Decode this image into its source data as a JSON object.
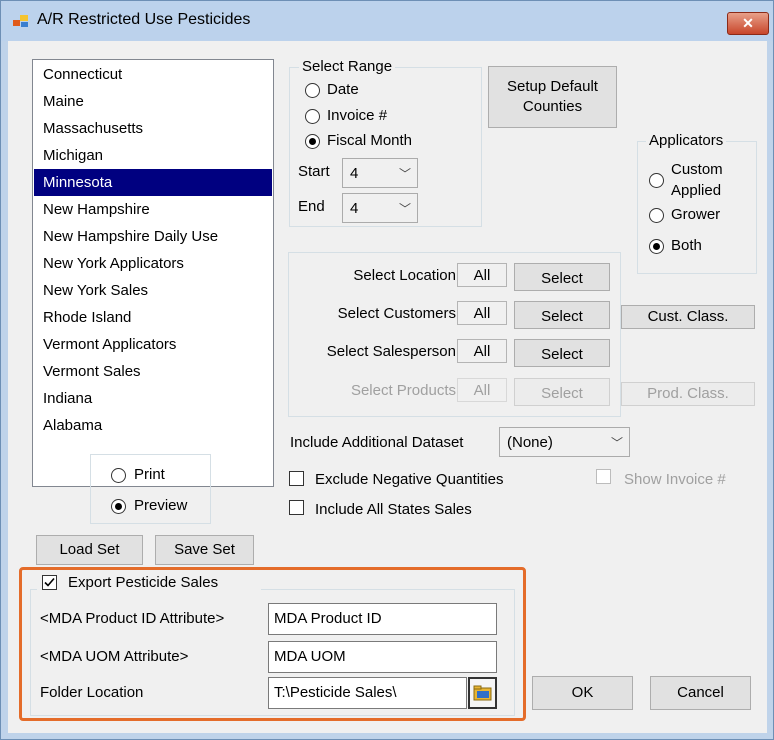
{
  "window": {
    "title": "A/R Restricted Use Pesticides",
    "close_label": "✕"
  },
  "states": {
    "items": [
      "Connecticut",
      "Maine",
      "Massachusetts",
      "Michigan",
      "Minnesota",
      "New Hampshire",
      "New Hampshire Daily Use",
      "New York Applicators",
      "New York Sales",
      "Rhode Island",
      "Vermont Applicators",
      "Vermont Sales",
      "Indiana",
      "Alabama"
    ],
    "selected": "Minnesota"
  },
  "output": {
    "print_label": "Print",
    "preview_label": "Preview",
    "selected": "Preview"
  },
  "buttons": {
    "load_set": "Load Set",
    "save_set": "Save Set",
    "setup_counties": "Setup Default Counties",
    "ok": "OK",
    "cancel": "Cancel"
  },
  "select_range": {
    "title": "Select Range",
    "date_label": "Date",
    "invoice_label": "Invoice #",
    "fiscal_label": "Fiscal Month",
    "selected": "Fiscal Month",
    "start_label": "Start",
    "start_value": "4",
    "end_label": "End",
    "end_value": "4"
  },
  "applicators": {
    "title": "Applicators",
    "custom_label_1": "Custom",
    "custom_label_2": "Applied",
    "grower_label": "Grower",
    "both_label": "Both",
    "selected": "Both"
  },
  "filters": {
    "location_label": "Select Location",
    "customers_label": "Select Customers",
    "salesperson_label": "Select Salesperson",
    "products_label": "Select Products",
    "all_text": "All",
    "select_text": "Select",
    "cust_class": "Cust. Class.",
    "prod_class": "Prod. Class."
  },
  "dataset": {
    "label": "Include Additional Dataset",
    "value": "(None)"
  },
  "options": {
    "exclude_negative": "Exclude Negative Quantities",
    "show_invoice": "Show Invoice #",
    "include_all_states": "Include All States Sales"
  },
  "export": {
    "label": "Export Pesticide Sales",
    "checked": true,
    "product_attr_label": "<MDA Product ID Attribute>",
    "product_attr_value": "MDA Product ID",
    "uom_attr_label": "<MDA UOM Attribute>",
    "uom_attr_value": "MDA UOM",
    "folder_label": "Folder Location",
    "folder_value": "T:\\Pesticide Sales\\"
  },
  "colors": {
    "selection": "#000080",
    "highlight_border": "#e46c2a",
    "titlebar": "#bcd2ec"
  }
}
